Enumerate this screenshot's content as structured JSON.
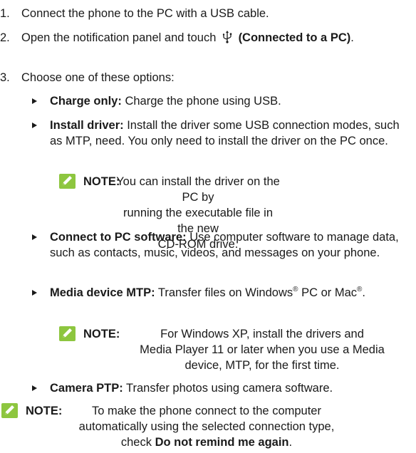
{
  "steps": [
    {
      "number": "1.",
      "text": "Connect the phone to the PC with a USB cable."
    },
    {
      "number": "2.",
      "text_before": "Open the notification panel and touch",
      "bold_text": "(Connected to a PC)",
      "text_after": ".",
      "icon": "usb-icon"
    },
    {
      "number": "3.",
      "text": "Choose one of these options:"
    }
  ],
  "options": [
    {
      "label": "Charge only:",
      "text": "Charge the phone using USB."
    },
    {
      "label": "Install driver:",
      "text": "Install the driver some USB connection modes, such as MTP, need. You only need to install the driver on the PC once."
    },
    {
      "label": "Connect to PC software:",
      "text": "Use computer software to manage data, such as contacts, music, videos, and messages on your phone."
    },
    {
      "label": "Media device MTP:",
      "text_before": "Transfer files on Windows",
      "reg1": "®",
      "text_middle": " PC or Mac",
      "reg2": "®",
      "text_after": "."
    },
    {
      "label": "Camera PTP:",
      "text": "Transfer photos using camera software."
    }
  ],
  "notes": {
    "install_driver": {
      "label": "NOTE:",
      "icon": "pencil-note-icon",
      "lines": [
        "You can install the driver on the PC by",
        "running the executable file in the new",
        "CD-ROM drive."
      ]
    },
    "media_device": {
      "label": "NOTE:",
      "icon": "pencil-note-icon",
      "lines": [
        "For Windows XP, install the drivers and",
        "Media Player 11 or later when you use a Media",
        "device, MTP, for the first time."
      ]
    },
    "final": {
      "label": "NOTE:",
      "icon": "pencil-note-icon",
      "lines": [
        "To make the phone connect to the computer",
        "automatically using the selected connection type,"
      ],
      "line3_before": "check",
      "line3_bold": "Do not remind me again",
      "line3_after": "."
    }
  },
  "colors": {
    "note_icon": "#8dc63f",
    "text": "#1a1a1a"
  }
}
